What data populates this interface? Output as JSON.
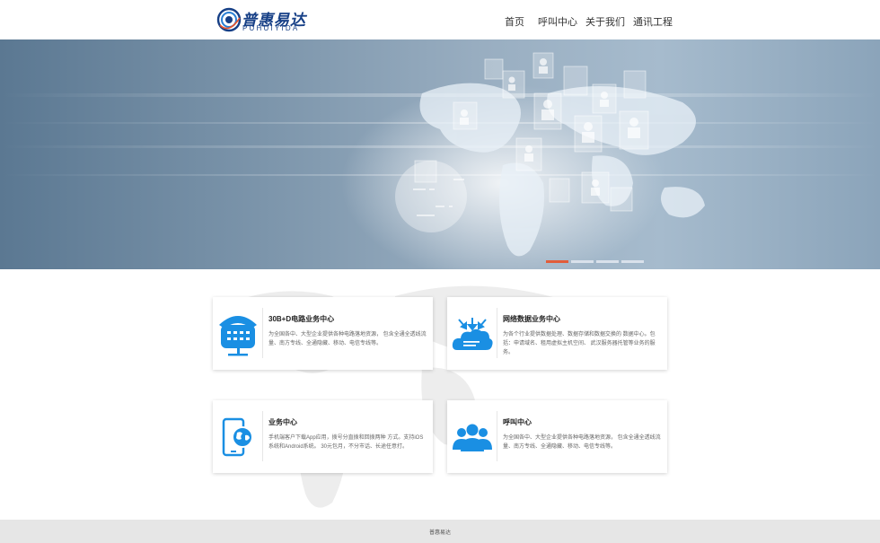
{
  "brand": {
    "name_cn": "普惠易达",
    "name_en": "PUHUIYIDA",
    "logo_icon": "swirl-logo-icon",
    "color": "#163f86"
  },
  "nav": {
    "items": [
      {
        "label": "首页"
      },
      {
        "label": "呼叫中心"
      },
      {
        "label": "关于我们"
      },
      {
        "label": "通讯工程"
      }
    ]
  },
  "banner": {
    "slide_count": 4,
    "active_slide": 1,
    "indicator_color": "#e8522a"
  },
  "services": [
    {
      "icon": "telephone-icon",
      "title": "30B+D电路业务中心",
      "description": "为全国各中、大型企业提供各种电路落地资源， 包含全通全透线流量、南方专线、全通隐藏、移动、电信专线等。"
    },
    {
      "icon": "cloud-download-icon",
      "title": "网络数据业务中心",
      "description": "为各个行业提供数据处理、数据存储和数据交换的 数据中心。包括：申请域名、租用虚拟主机空间、 武汉服务器托管等业务的服务。"
    },
    {
      "icon": "mobile-globe-icon",
      "title": "业务中心",
      "description": "手机端客户下载App应用，拨号分直拨和回拨两种 方式。支持iOS系统和Android系统。 30元包月，不分市话、长途任意打。"
    },
    {
      "icon": "users-group-icon",
      "title": "呼叫中心",
      "description": "为全国各中、大型企业提供各种电路落地资源， 包含全通全透线流量、南方专线、全通隐藏、移动、电信专线等。"
    }
  ],
  "colors": {
    "accent_blue": "#1a8fe3",
    "footer_bg": "#e6e6e6"
  },
  "footer": {
    "text": "普惠易达"
  }
}
